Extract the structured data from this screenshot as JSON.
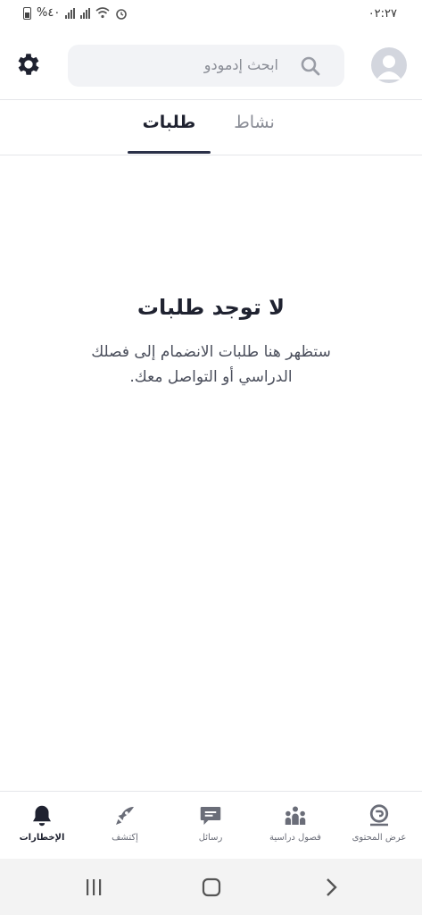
{
  "status_bar": {
    "time": "٠٢:٢٧",
    "battery_text": "%٤٠"
  },
  "header": {
    "search_placeholder": "ابحث إدمودو",
    "settings_icon": "gear-icon",
    "avatar_icon": "user-avatar-icon"
  },
  "tabs": [
    {
      "label": "طلبات",
      "active": true
    },
    {
      "label": "نشاط",
      "active": false
    }
  ],
  "empty_state": {
    "title": "لا توجد طلبات",
    "description": "ستظهر هنا طلبات الانضمام إلى فصلك الدراسي أو التواصل معك."
  },
  "bottom_nav": [
    {
      "label": "الإخطارات",
      "icon": "bell-icon",
      "active": true
    },
    {
      "label": "إكتشف",
      "icon": "rocket-icon",
      "active": false
    },
    {
      "label": "رسائل",
      "icon": "message-icon",
      "active": false
    },
    {
      "label": "فصول دراسية",
      "icon": "classes-icon",
      "active": false
    },
    {
      "label": "عرض المحتوى",
      "icon": "content-icon",
      "active": false
    }
  ],
  "colors": {
    "accent": "#2a3048",
    "search_bg": "#f2f3f6",
    "muted_text": "#8a8d96"
  }
}
